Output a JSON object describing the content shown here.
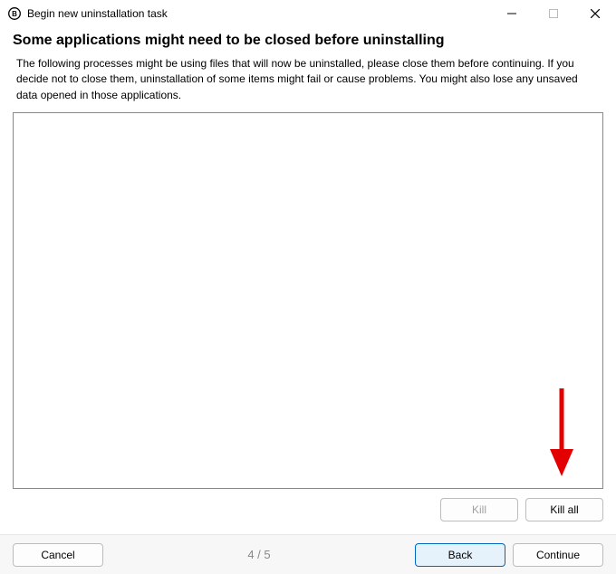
{
  "titlebar": {
    "title": "Begin new uninstallation task"
  },
  "heading": "Some applications might need to be closed before uninstalling",
  "description": "The following processes might be using files that will now be uninstalled, please close them before continuing. If you decide not to close them, uninstallation of some items might fail or cause problems. You might also lose any unsaved data opened in those applications.",
  "buttons": {
    "kill": "Kill",
    "kill_all": "Kill all",
    "cancel": "Cancel",
    "back": "Back",
    "continue": "Continue"
  },
  "step_indicator": "4 / 5",
  "annotation": {
    "arrow_color": "#e20000"
  }
}
